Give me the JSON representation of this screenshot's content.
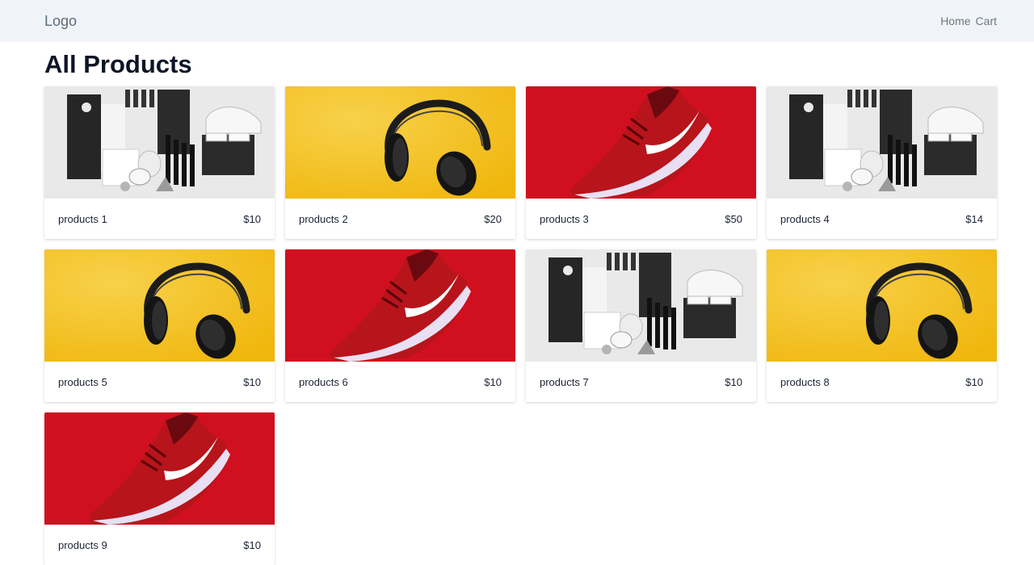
{
  "navbar": {
    "logo": "Logo",
    "links": [
      "Home",
      "Cart"
    ]
  },
  "page_title": "All Products",
  "products": [
    {
      "name": "products 1",
      "price": "$10",
      "image": "cosmetics"
    },
    {
      "name": "products 2",
      "price": "$20",
      "image": "headphones"
    },
    {
      "name": "products 3",
      "price": "$50",
      "image": "sneaker"
    },
    {
      "name": "products 4",
      "price": "$14",
      "image": "cosmetics"
    },
    {
      "name": "products 5",
      "price": "$10",
      "image": "headphones"
    },
    {
      "name": "products 6",
      "price": "$10",
      "image": "sneaker"
    },
    {
      "name": "products 7",
      "price": "$10",
      "image": "cosmetics"
    },
    {
      "name": "products 8",
      "price": "$10",
      "image": "headphones"
    },
    {
      "name": "products 9",
      "price": "$10",
      "image": "sneaker"
    }
  ],
  "image_colors": {
    "headphones_bg": "#f5c20f",
    "sneaker_bg": "#d0101e",
    "cosmetics_bg": "#e9e9e9"
  }
}
